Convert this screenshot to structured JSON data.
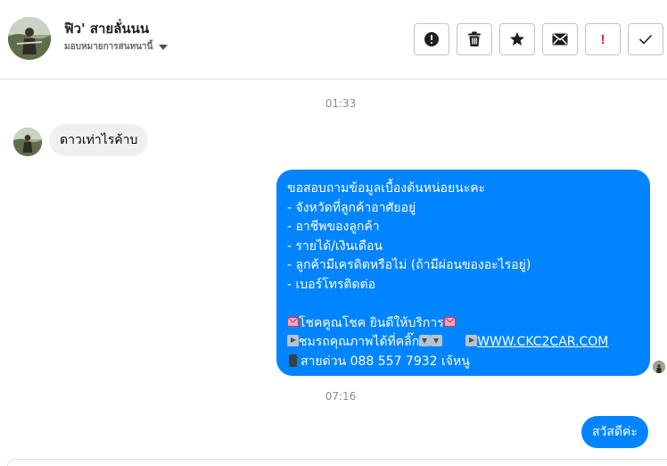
{
  "header": {
    "contact_name": "ฟิว' สายลั่นนน",
    "assignee_label": "มอบหมายการสนทนานี้"
  },
  "actions": [
    {
      "name": "spam-button",
      "icon": "alert-circle-icon"
    },
    {
      "name": "delete-button",
      "icon": "trash-icon"
    },
    {
      "name": "star-button",
      "icon": "star-icon"
    },
    {
      "name": "mark-unread-button",
      "icon": "envelope-icon"
    },
    {
      "name": "follow-up-button",
      "icon": "exclamation-icon",
      "text": "!"
    },
    {
      "name": "mark-done-button",
      "icon": "checkmark-icon"
    }
  ],
  "messages": {
    "timestamp_1": "01:33",
    "incoming_1": "ดาวเท่าไรค้าบ",
    "outgoing_1": {
      "lines": [
        "ขอสอบถามข้อมูลเบื้องต้นหน่อยนะคะ",
        "- จังหวัดที่ลูกค้าอาศัยอยู่",
        "- อาชีพของลูกค้า",
        "- รายได้/เงินเดือน",
        "- ลูกค้ามีเครดิตหรือไม่ (ถ้ามีผ่อนของอะไรอยู่)",
        "- เบอร์โทรติดต่อ"
      ],
      "promo": "โชคคูณโชค ยินดีให้บริการ",
      "gallery_text": "ชมรถคุณภาพได้ที่คลิ๊ก",
      "website": "WWW.CKC2CAR.COM",
      "hotline": "สายด่วน 088 557 7932 เจ้หนู"
    },
    "timestamp_2": "07:16",
    "outgoing_2": "สวัสดีค่ะ"
  },
  "colors": {
    "accent": "#0084ff",
    "incoming_bubble": "#f0f0f0",
    "timestamp": "#8a8d91",
    "follow_up_red": "#e41e3f"
  }
}
